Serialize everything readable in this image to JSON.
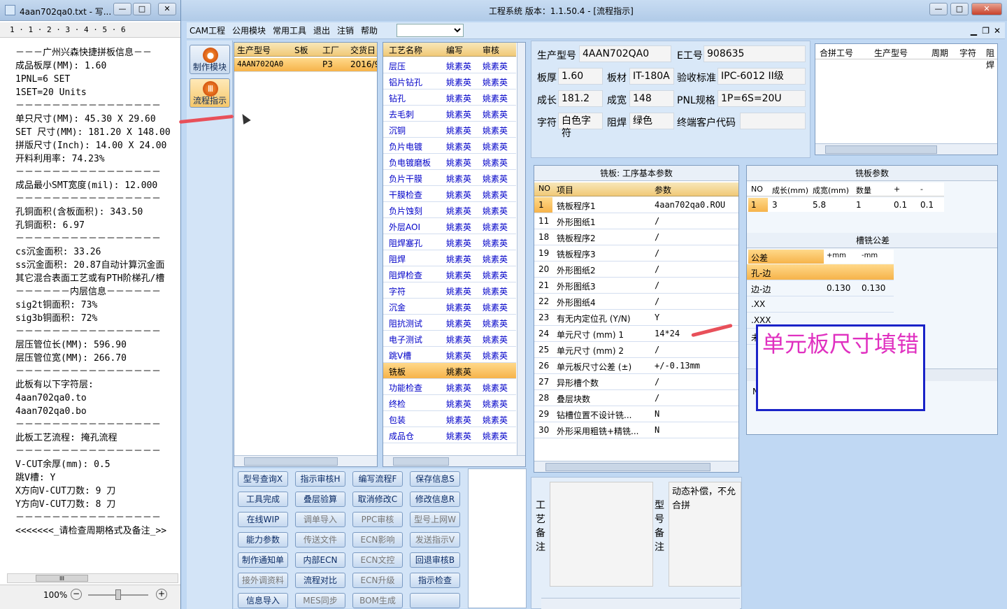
{
  "notepad": {
    "title": "4aan702qa0.txt - 写...",
    "ruler": "1 · 1 · 2 · 3 · 4 · 5 · 6",
    "zoom": "100%",
    "scroll_mark": "III",
    "lines": [
      "－－－广州兴森快捷拼板信息－－",
      "成品板厚(MM): 1.60",
      "1PNL=6 SET",
      "1SET=20 Units",
      "－－－－－－－－－－－－－－－－",
      "单只尺寸(MM): 45.30 X 29.60",
      "SET 尺寸(MM): 181.20 X 148.00",
      "拼版尺寸(Inch): 14.00 X 24.00",
      "开料利用率: 74.23%",
      "－－－－－－－－－－－－－－－－",
      "成品最小SMT宽度(mil): 12.000",
      "－－－－－－－－－－－－－－－－",
      "孔铜面积(含板面积): 343.50",
      "孔铜面积: 6.97",
      "－－－－－－－－－－－－－－－－",
      "cs沉金面积: 33.26",
      "ss沉金面积: 20.87自动计算沉金面",
      "其它混合表面工艺或有PTH阶梯孔/槽",
      "－－－－－－内层信息－－－－－－",
      "sig2t铜面积: 73%",
      "sig3b铜面积: 72%",
      "－－－－－－－－－－－－－－－－",
      "层压管位长(MM): 596.90",
      "层压管位宽(MM): 266.70",
      "－－－－－－－－－－－－－－－－",
      "此板有以下字符层:",
      "4aan702qa0.to",
      "4aan702qa0.bo",
      "－－－－－－－－－－－－－－－－",
      "此板工艺流程: 掩孔流程",
      "－－－－－－－－－－－－－－－－",
      "V-CUT余厚(mm): 0.5",
      "跳V槽: Y",
      "X方向V-CUT刀数: 9 刀",
      "Y方向V-CUT刀数: 8 刀",
      "－－－－－－－－－－－－－－－－",
      "<<<<<<<_请检查周期格式及备注_>>"
    ]
  },
  "app": {
    "title": "工程系统  版本：1.1.50.4 - [流程指示]",
    "menu": [
      "CAM工程",
      "公用模块",
      "常用工具",
      "退出",
      "注销",
      "帮助"
    ],
    "nav": [
      {
        "label": "制作模块",
        "icon": "fire-icon"
      },
      {
        "label": "流程指示",
        "icon": "flow-icon"
      }
    ],
    "models": {
      "headers": [
        "生产型号",
        "S板",
        "工厂",
        "交货日"
      ],
      "rows": [
        [
          "4AAN702QA0",
          "",
          "P3",
          "2016/9"
        ]
      ]
    },
    "process": {
      "headers": [
        "工艺名称",
        "编写",
        "审核"
      ],
      "rows": [
        [
          "层压",
          "姚素英",
          "姚素英"
        ],
        [
          "铝片钻孔",
          "姚素英",
          "姚素英"
        ],
        [
          "钻孔",
          "姚素英",
          "姚素英"
        ],
        [
          "去毛刺",
          "姚素英",
          "姚素英"
        ],
        [
          "沉铜",
          "姚素英",
          "姚素英"
        ],
        [
          "负片电镀",
          "姚素英",
          "姚素英"
        ],
        [
          "负电镀磨板",
          "姚素英",
          "姚素英"
        ],
        [
          "负片干膜",
          "姚素英",
          "姚素英"
        ],
        [
          "干膜检查",
          "姚素英",
          "姚素英"
        ],
        [
          "负片蚀刻",
          "姚素英",
          "姚素英"
        ],
        [
          "外层AOI",
          "姚素英",
          "姚素英"
        ],
        [
          "阻焊塞孔",
          "姚素英",
          "姚素英"
        ],
        [
          "阻焊",
          "姚素英",
          "姚素英"
        ],
        [
          "阻焊检查",
          "姚素英",
          "姚素英"
        ],
        [
          "字符",
          "姚素英",
          "姚素英"
        ],
        [
          "沉金",
          "姚素英",
          "姚素英"
        ],
        [
          "阻抗测试",
          "姚素英",
          "姚素英"
        ],
        [
          "电子测试",
          "姚素英",
          "姚素英"
        ],
        [
          "跳V槽",
          "姚素英",
          "姚素英"
        ],
        [
          "铣板",
          "姚素英",
          ""
        ],
        [
          "功能检查",
          "姚素英",
          "姚素英"
        ],
        [
          "终检",
          "姚素英",
          "姚素英"
        ],
        [
          "包装",
          "姚素英",
          "姚素英"
        ],
        [
          "成品仓",
          "姚素英",
          "姚素英"
        ]
      ]
    },
    "buttons": [
      [
        "型号查询X",
        "指示审核H",
        "编写流程F",
        "保存信息S"
      ],
      [
        "工具完成",
        "叠层验算",
        "取消修改C",
        "修改信息R"
      ],
      [
        "在线WIP",
        "调单导入",
        "PPC审核",
        "型号上网W"
      ],
      [
        "能力参数",
        "传送文件",
        "ECN影响",
        "发送指示V"
      ],
      [
        "制作通知单",
        "内部ECN",
        "ECN文控",
        "回退审核B"
      ],
      [
        "接外调资料",
        "流程对比",
        "ECN升级",
        "指示检查"
      ],
      [
        "信息导入",
        "MES同步",
        "BOM生成",
        ""
      ]
    ],
    "button_disabled": [
      [
        false,
        false,
        false,
        false
      ],
      [
        false,
        false,
        false,
        false
      ],
      [
        false,
        true,
        true,
        true
      ],
      [
        false,
        true,
        true,
        true
      ],
      [
        false,
        false,
        true,
        false
      ],
      [
        true,
        false,
        true,
        false
      ],
      [
        false,
        true,
        true,
        false
      ]
    ],
    "info": {
      "labels": {
        "model": "生产型号",
        "eno": "E工号",
        "thick": "板厚",
        "material": "板材",
        "std": "验收标准",
        "len": "成长",
        "wid": "成宽",
        "pnl": "PNL规格",
        "char": "字符",
        "mask": "阻焊",
        "cust": "终端客户代码"
      },
      "values": {
        "model": "4AAN702QA0",
        "eno": "908635",
        "thick": "1.60",
        "material": "IT-180A",
        "std": "IPC-6012 II级",
        "len": "181.2",
        "wid": "148",
        "pnl": "1P=6S=20U",
        "char": "白色字符",
        "mask": "绿色",
        "cust": ""
      }
    },
    "merge": {
      "headers": [
        "合拼工号",
        "生产型号",
        "周期",
        "字符",
        "阻焊"
      ]
    },
    "mill": {
      "title": "铣板: 工序基本参数",
      "headers": [
        "NO",
        "项目",
        "参数"
      ],
      "rows": [
        [
          "1",
          "铣板程序1",
          "4aan702qa0.ROU"
        ],
        [
          "11",
          "外形图纸1",
          "/"
        ],
        [
          "18",
          "铣板程序2",
          "/"
        ],
        [
          "19",
          "铣板程序3",
          "/"
        ],
        [
          "20",
          "外形图纸2",
          "/"
        ],
        [
          "21",
          "外形图纸3",
          "/"
        ],
        [
          "22",
          "外形图纸4",
          "/"
        ],
        [
          "23",
          "有无内定位孔 (Y/N)",
          "Y"
        ],
        [
          "24",
          "单元尺寸 (mm) 1",
          "14*24"
        ],
        [
          "25",
          "单元尺寸 (mm) 2",
          "/"
        ],
        [
          "26",
          "单元板尺寸公差 (±)",
          "+/-0.13mm"
        ],
        [
          "27",
          "异形槽个数",
          "/"
        ],
        [
          "28",
          "叠层块数",
          "/"
        ],
        [
          "29",
          "钻槽位置不设计铣...",
          "N"
        ],
        [
          "30",
          "外形采用粗铣+精铣...",
          "N"
        ]
      ]
    },
    "millparam": {
      "title": "铣板参数",
      "headers": [
        "NO",
        "成长(mm)",
        "成宽(mm)",
        "数量",
        "+",
        "-"
      ],
      "rows": [
        [
          "1",
          "3",
          "5.8",
          "1",
          "0.1",
          "0.1"
        ]
      ]
    },
    "slot": {
      "title": "槽铣公差",
      "headers": [
        "公差",
        "+mm",
        "-mm"
      ],
      "rows": [
        [
          "孔-边",
          "",
          ""
        ],
        [
          "边-边",
          "0.130",
          "0.130"
        ],
        [
          ".XX",
          "",
          ""
        ],
        [
          ".XXX",
          "",
          ""
        ],
        [
          "未",
          "",
          ""
        ]
      ],
      "hidden": "N"
    },
    "remarks": {
      "craft_label": "工艺备注",
      "model_label": "型号备注",
      "model_text": "动态补偿，不允合拼"
    },
    "annotation": "单元板尺寸填错"
  }
}
